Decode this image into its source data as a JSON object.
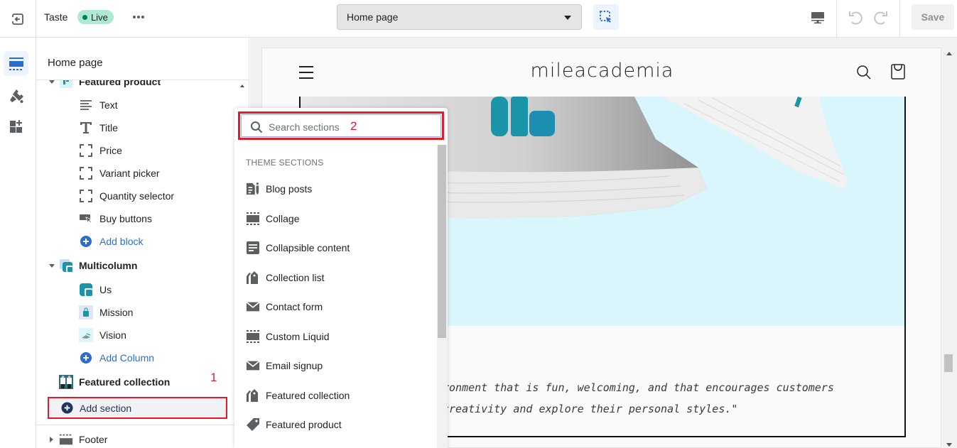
{
  "topbar": {
    "theme_name": "Taste",
    "status_badge": "Live",
    "page_selector": "Home page",
    "save_label": "Save"
  },
  "sidebar": {
    "title": "Home page",
    "tree": [
      {
        "type": "section",
        "label": "Featured product",
        "expanded": true,
        "icon": "product-thumbnail"
      },
      {
        "type": "block",
        "label": "Text",
        "icon": "text-lines-icon"
      },
      {
        "type": "block",
        "label": "Title",
        "icon": "title-T-icon"
      },
      {
        "type": "block",
        "label": "Price",
        "icon": "dashed-frame-icon"
      },
      {
        "type": "block",
        "label": "Variant picker",
        "icon": "dashed-frame-icon"
      },
      {
        "type": "block",
        "label": "Quantity selector",
        "icon": "dashed-frame-icon"
      },
      {
        "type": "block",
        "label": "Buy buttons",
        "icon": "buy-button-icon"
      },
      {
        "type": "add",
        "label": "Add block",
        "icon": "plus-circle-icon"
      },
      {
        "type": "section",
        "label": "Multicolumn",
        "expanded": true,
        "icon": "multicolumn-thumbnail"
      },
      {
        "type": "block",
        "label": "Us",
        "icon": "logo-thumbnail"
      },
      {
        "type": "block",
        "label": "Mission",
        "icon": "mission-thumbnail"
      },
      {
        "type": "block",
        "label": "Vision",
        "icon": "vision-thumbnail"
      },
      {
        "type": "add",
        "label": "Add Column",
        "icon": "plus-circle-icon"
      },
      {
        "type": "section",
        "label": "Featured collection",
        "icon": "collection-thumbnail"
      }
    ],
    "add_section_label": "Add section",
    "footer_label": "Footer",
    "annotation_1": "1"
  },
  "popover": {
    "search_placeholder": "Search sections",
    "annotation_2": "2",
    "heading": "THEME SECTIONS",
    "items": [
      {
        "label": "Blog posts",
        "icon": "blog-icon"
      },
      {
        "label": "Collage",
        "icon": "collage-icon"
      },
      {
        "label": "Collapsible content",
        "icon": "collapsible-icon"
      },
      {
        "label": "Collection list",
        "icon": "collection-tag-icon"
      },
      {
        "label": "Contact form",
        "icon": "envelope-icon"
      },
      {
        "label": "Custom Liquid",
        "icon": "custom-liquid-icon"
      },
      {
        "label": "Email signup",
        "icon": "envelope-icon"
      },
      {
        "label": "Featured collection",
        "icon": "collection-tag-icon"
      },
      {
        "label": "Featured product",
        "icon": "tag-icon"
      }
    ]
  },
  "preview": {
    "store_name": "mileacademia",
    "quote_line_1": "ronment that is fun, welcoming, and that encourages customers",
    "quote_line_2": "creativity and explore their personal styles.\""
  }
}
